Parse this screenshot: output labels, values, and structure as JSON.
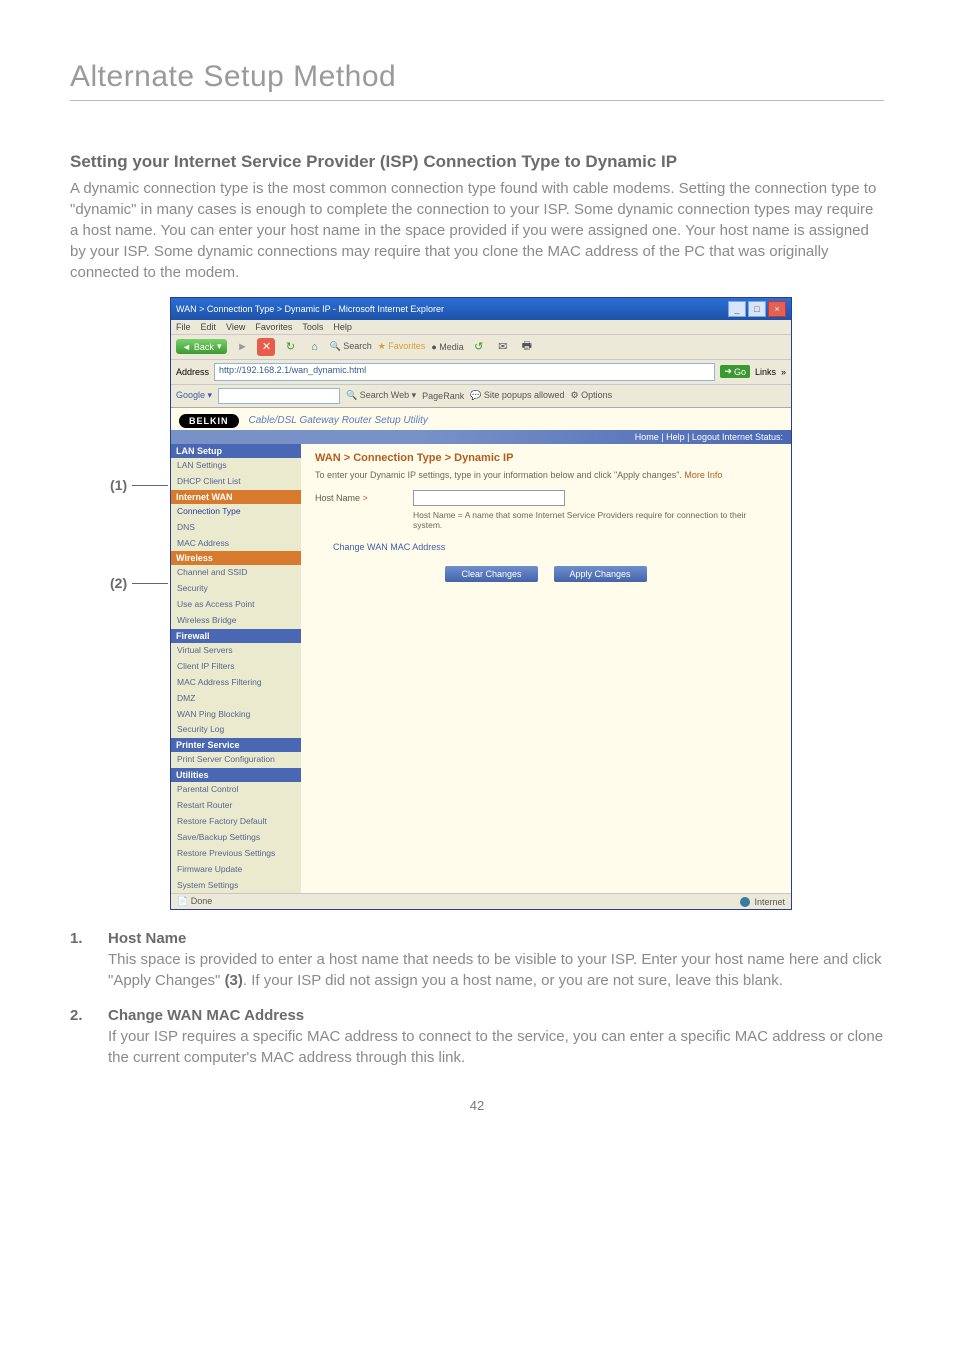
{
  "chapter_title": "Alternate Setup Method",
  "section": {
    "title": "Setting your Internet Service Provider (ISP) Connection Type to Dynamic IP",
    "body": "A dynamic connection type is the most common connection type found with cable modems. Setting the connection type to \"dynamic\" in many cases is enough to complete the connection to your ISP. Some dynamic connection types may require a host name. You can enter your host name in the space provided if you were assigned one. Your host name is assigned by your ISP. Some dynamic connections may require that you clone the MAC address of the PC that was originally connected to the modem."
  },
  "callouts": {
    "c1": "(1)",
    "c2": "(2)",
    "c3": "(3)"
  },
  "ie": {
    "title": "WAN > Connection Type > Dynamic IP - Microsoft Internet Explorer",
    "menu": [
      "File",
      "Edit",
      "View",
      "Favorites",
      "Tools",
      "Help"
    ],
    "toolbar": {
      "back": "Back",
      "search": "Search",
      "favorites": "Favorites",
      "media": "Media"
    },
    "address_label": "Address",
    "address_value": "http://192.168.2.1/wan_dynamic.html",
    "go": "Go",
    "links": "Links",
    "google": {
      "brand": "Google",
      "search": "Search Web",
      "pagerank": "PageRank",
      "popups": "Site popups allowed",
      "options": "Options"
    },
    "status_done": "Done",
    "status_zone": "Internet"
  },
  "router": {
    "brand": "BELKIN",
    "tag": "Cable/DSL Gateway Router Setup Utility",
    "status_links": "Home | Help | Logout   Internet Status:",
    "nav": {
      "lan_setup": "LAN Setup",
      "lan_items": [
        "LAN Settings",
        "DHCP Client List"
      ],
      "internet_wan": "Internet WAN",
      "wan_items": [
        "Connection Type",
        "DNS",
        "MAC Address"
      ],
      "wireless": "Wireless",
      "wireless_items": [
        "Channel and SSID",
        "Security",
        "Use as Access Point",
        "Wireless Bridge"
      ],
      "firewall": "Firewall",
      "firewall_items": [
        "Virtual Servers",
        "Client IP Filters",
        "MAC Address Filtering",
        "DMZ",
        "WAN Ping Blocking",
        "Security Log"
      ],
      "printer": "Printer Service",
      "printer_items": [
        "Print Server Configuration"
      ],
      "utilities": "Utilities",
      "utilities_items": [
        "Parental Control",
        "Restart Router",
        "Restore Factory Default",
        "Save/Backup Settings",
        "Restore Previous Settings",
        "Firmware Update",
        "System Settings"
      ]
    },
    "breadcrumb": "WAN > Connection Type > Dynamic IP",
    "intro_text": "To enter your Dynamic IP settings, type in your information below and click \"Apply changes\". ",
    "more_info": "More Info",
    "hostname_label": "Host Name",
    "hostname_gt": ">",
    "hostname_note": "Host Name = A name that some Internet Service Providers require for connection to their system.",
    "change_mac": "Change WAN MAC Address",
    "clear_btn": "Clear Changes",
    "apply_btn": "Apply Changes"
  },
  "list": {
    "items": [
      {
        "num": "1.",
        "title": "Host Name",
        "body_a": "This space is provided to enter a host name that needs to be visible to your ISP. Enter your host name here and click \"Apply Changes\" ",
        "ref": "(3)",
        "body_b": ". If your ISP did not assign you a host name, or you are not sure, leave this blank."
      },
      {
        "num": "2.",
        "title": "Change WAN MAC Address",
        "body_a": "If your ISP requires a specific MAC address to connect to the service, you can enter a specific MAC address or clone the current computer's MAC address through this link.",
        "ref": "",
        "body_b": ""
      }
    ]
  },
  "page_number": "42"
}
